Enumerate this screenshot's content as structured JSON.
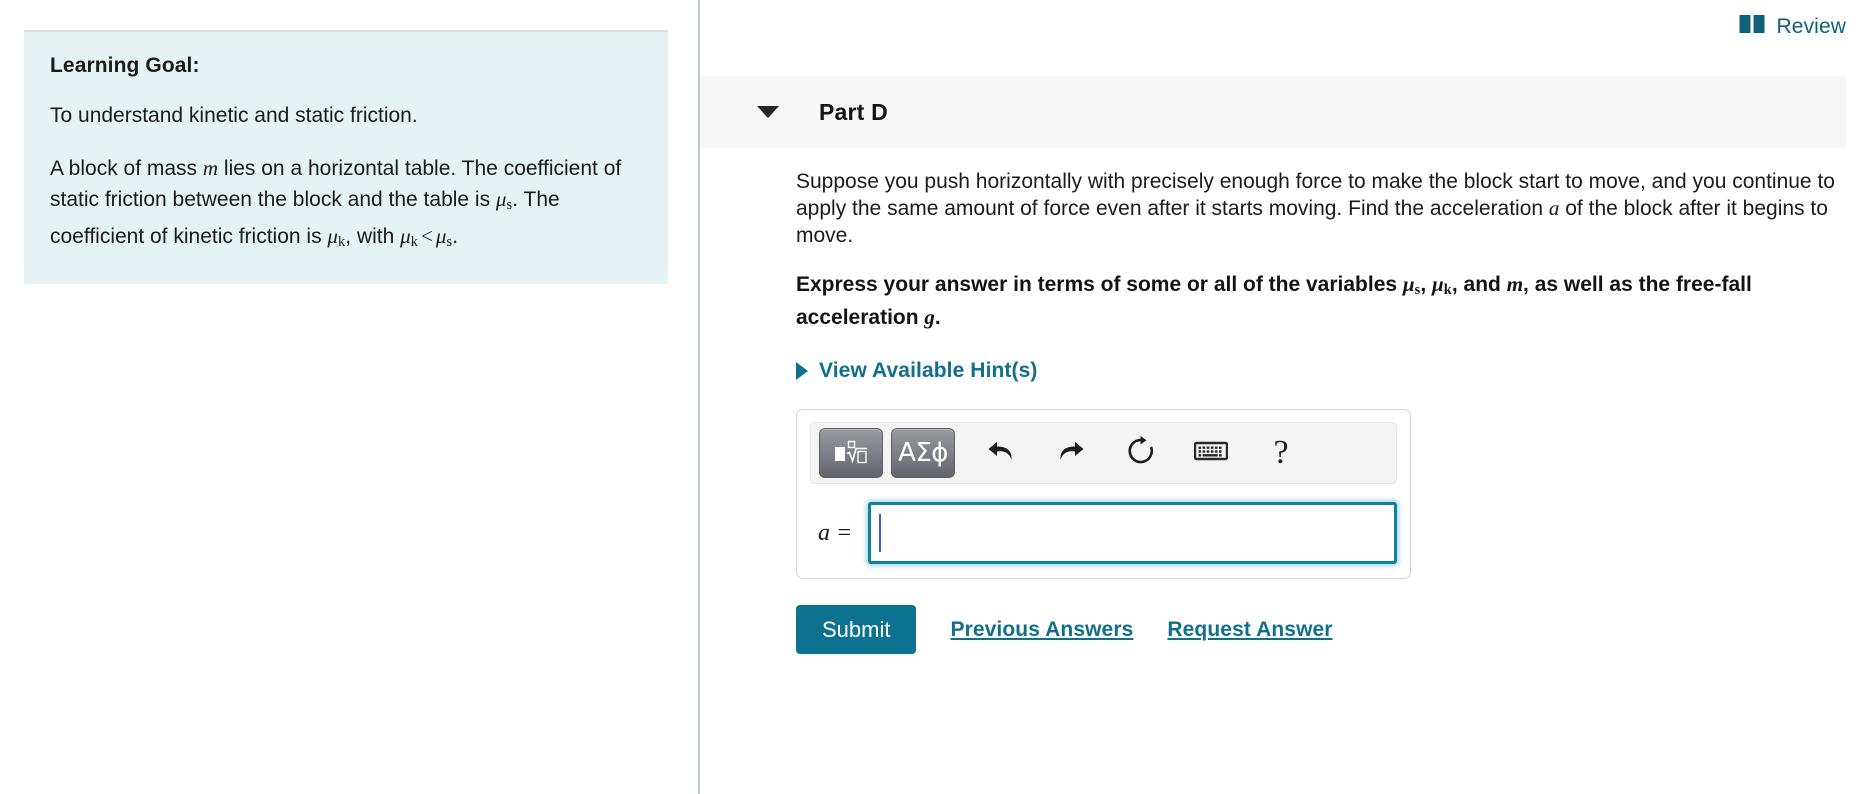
{
  "left_panel": {
    "title": "Learning Goal:",
    "goal_text": "To understand kinetic and static friction.",
    "problem_intro": "A block of mass ",
    "problem_var_m": "m",
    "problem_mid_1": " lies on a horizontal table. The coefficient of static friction between the block and the table is ",
    "problem_mu_s_base": "μ",
    "problem_mu_s_sub": "s",
    "problem_mid_2": ". The coefficient of kinetic friction is ",
    "problem_mu_k_base": "μ",
    "problem_mu_k_sub": "k",
    "problem_mid_3": ", with ",
    "problem_relation": "<",
    "problem_end": "."
  },
  "header": {
    "review_label": "Review",
    "review_icon": "book-icon"
  },
  "part": {
    "collapse_icon": "caret-down-icon",
    "title": "Part D",
    "question_line_1": "Suppose you push horizontally with precisely enough force to make the block start to",
    "question_line_2": "move, and you continue to apply the same amount of force even after it starts moving.",
    "question_line_3_pre": "Find the acceleration ",
    "question_line_3_var": "a",
    "question_line_3_post": " of the block after it begins to move.",
    "instruction_pre": "Express your answer in terms of some or all of the variables ",
    "instruction_mu_s_base": "μ",
    "instruction_mu_s_sub": "s",
    "instruction_comma_1": ", ",
    "instruction_mu_k_base": "μ",
    "instruction_mu_k_sub": "k",
    "instruction_mid": ", and ",
    "instruction_var_m": "m",
    "instruction_post": ", as well as the free-fall acceleration ",
    "instruction_var_g": "g",
    "instruction_period": ".",
    "hint_label": "View Available Hint(s)",
    "hint_icon": "caret-right-icon"
  },
  "answer": {
    "label": "a =",
    "value": "",
    "toolbar": {
      "template_button_icon": "math-template-icon",
      "greek_button_label": "ΑΣϕ",
      "undo_icon": "undo-arrow-icon",
      "redo_icon": "redo-arrow-icon",
      "reset_icon": "reset-circular-arrow-icon",
      "keyboard_icon": "keyboard-icon",
      "help_label": "?"
    }
  },
  "actions": {
    "submit_label": "Submit",
    "previous_answers_label": "Previous Answers",
    "request_answer_label": "Request Answer"
  },
  "colors": {
    "teal_accent": "#10708c",
    "submit_bg": "#0c7290",
    "panel_bg": "#e4f3f4",
    "part_header_bg": "#f7f7f7",
    "divider": "#b7c9da",
    "input_border": "#1080a0",
    "cursor": "#3b5bd6"
  }
}
